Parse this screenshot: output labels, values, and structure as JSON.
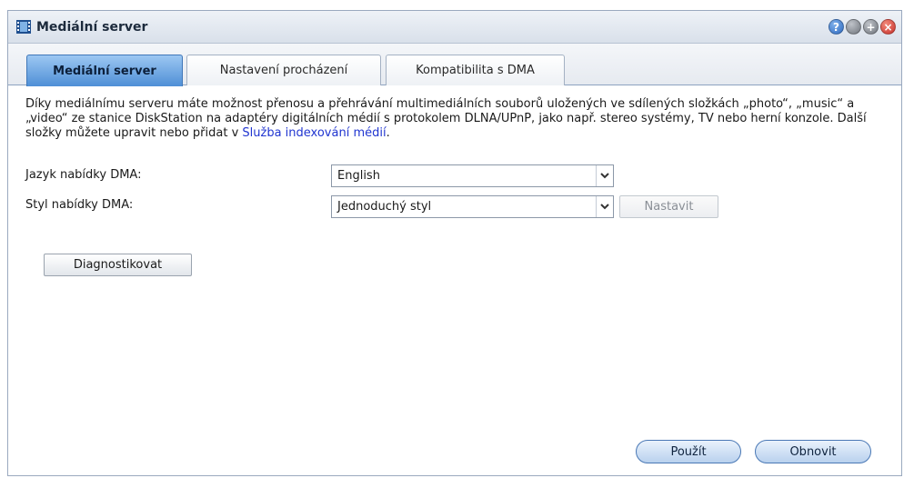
{
  "window": {
    "title": "Mediální server",
    "controls": [
      {
        "name": "help-icon",
        "glyph": "?"
      },
      {
        "name": "minimize-icon",
        "glyph": ""
      },
      {
        "name": "maximize-icon",
        "glyph": "+"
      },
      {
        "name": "close-icon",
        "glyph": "×"
      }
    ]
  },
  "tabs": [
    {
      "label": "Mediální server",
      "active": true
    },
    {
      "label": "Nastavení procházení",
      "active": false
    },
    {
      "label": "Kompatibilita s DMA",
      "active": false
    }
  ],
  "description": {
    "text": "Díky mediálnímu serveru máte možnost přenosu a přehrávání multimediálních souborů uložených ve sdílených složkách „photo“, „music“ a „video“ ze stanice DiskStation na adaptéry digitálních médií s protokolem DLNA/UPnP, jako např. stereo systémy, TV nebo herní konzole. Další složky můžete upravit nebo přidat v ",
    "link": "Služba indexování médií",
    "suffix": "."
  },
  "form": {
    "language_label": "Jazyk nabídky DMA:",
    "language_value": "English",
    "style_label": "Styl nabídky DMA:",
    "style_value": "Jednoduchý styl",
    "configure_button": "Nastavit"
  },
  "buttons": {
    "diagnose": "Diagnostikovat",
    "apply": "Použít",
    "reset": "Obnovit"
  },
  "colors": {
    "accent": "#4f8fd6",
    "link": "#2035d0"
  }
}
